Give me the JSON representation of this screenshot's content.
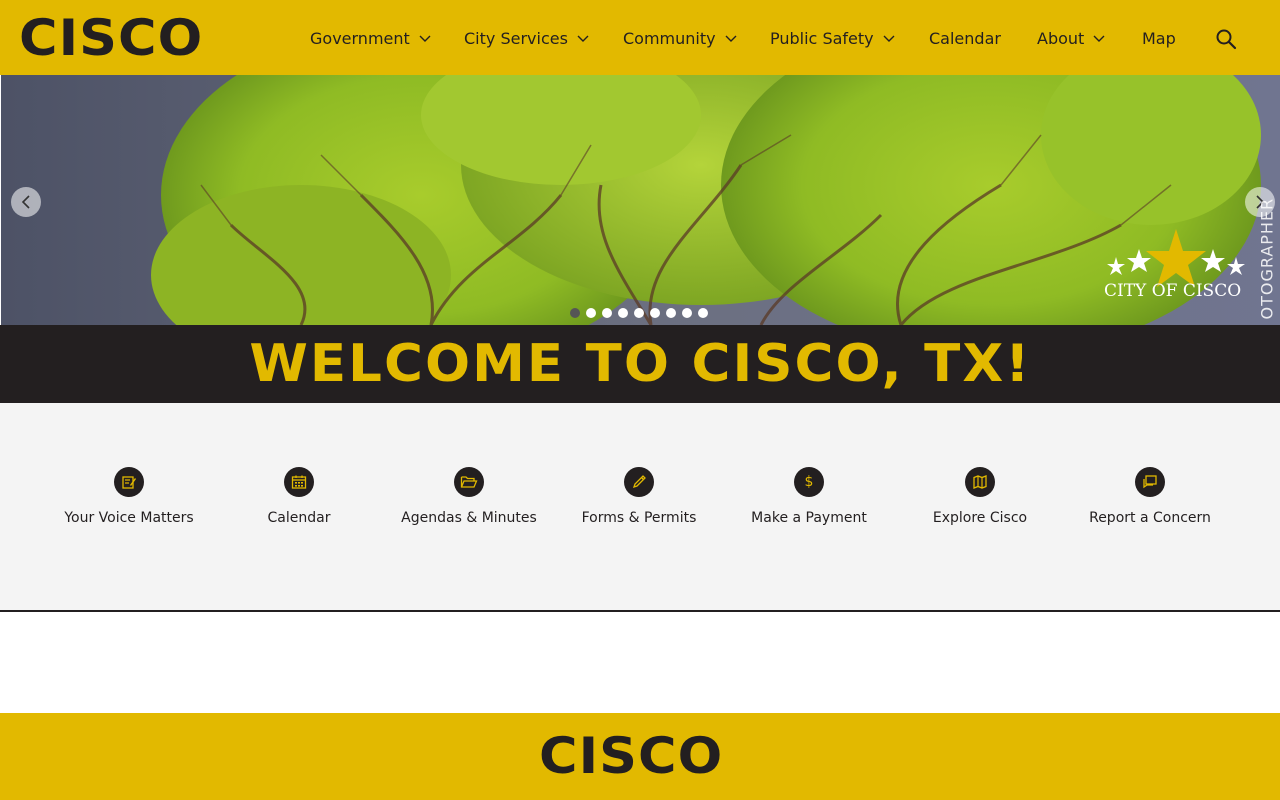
{
  "header": {
    "logo": "CISCO",
    "nav": [
      {
        "label": "Government",
        "dropdown": true
      },
      {
        "label": "City Services",
        "dropdown": true
      },
      {
        "label": "Community",
        "dropdown": true
      },
      {
        "label": "Public Safety",
        "dropdown": true
      },
      {
        "label": "Calendar",
        "dropdown": false
      },
      {
        "label": "About",
        "dropdown": true
      },
      {
        "label": "Map",
        "dropdown": false
      }
    ],
    "search_icon": "search-icon"
  },
  "hero": {
    "logo_text": "CITY OF CISCO",
    "photographer_text": "OTOGRAPHER",
    "slide_count": 9,
    "active_slide": 1,
    "prev_icon": "chevron-left-icon",
    "next_icon": "chevron-right-icon"
  },
  "welcome": {
    "title": "WELCOME TO CISCO, TX!"
  },
  "quick_links": [
    {
      "label": "Your Voice Matters",
      "icon": "clipboard-edit-icon"
    },
    {
      "label": "Calendar",
      "icon": "calendar-icon"
    },
    {
      "label": "Agendas & Minutes",
      "icon": "folder-open-icon"
    },
    {
      "label": "Forms & Permits",
      "icon": "pencil-icon"
    },
    {
      "label": "Make a Payment",
      "icon": "dollar-icon"
    },
    {
      "label": "Explore Cisco",
      "icon": "map-icon"
    },
    {
      "label": "Report a Concern",
      "icon": "speech-bubble-icon"
    }
  ],
  "footer": {
    "logo": "CISCO"
  },
  "colors": {
    "brand_yellow": "#e2b900",
    "brand_dark": "#231f20",
    "panel_gray": "#f4f4f4"
  }
}
